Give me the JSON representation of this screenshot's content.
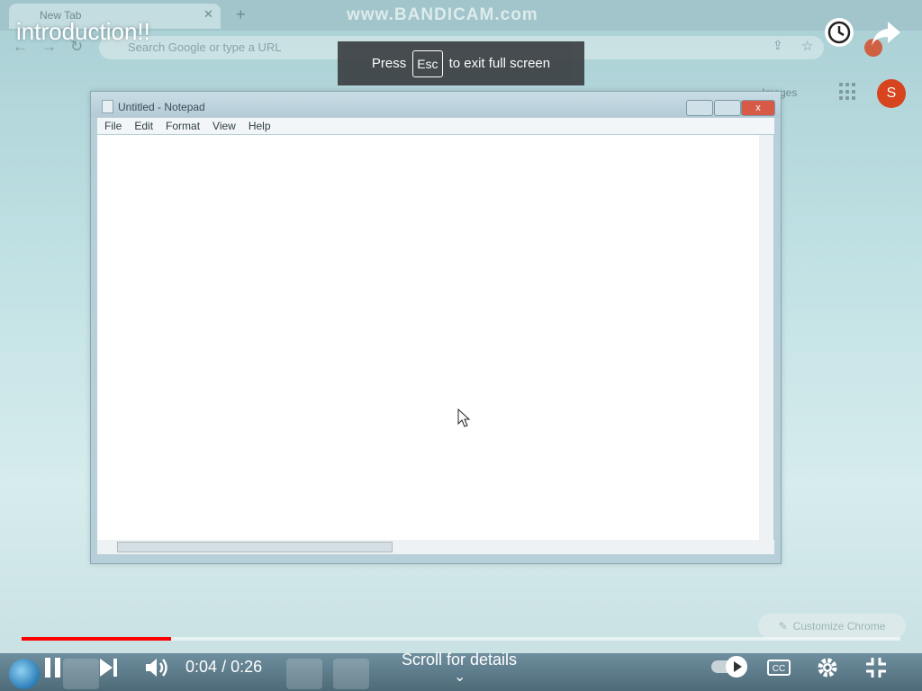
{
  "video": {
    "title": "introduction!!",
    "watermark": "www.BANDICAM.com",
    "time_current": "0:04",
    "time_sep": "/",
    "time_total": "0:26",
    "progress_fraction": 0.17,
    "scroll_hint": "Scroll for details",
    "accent": "#ff0000"
  },
  "toast": {
    "press": "Press",
    "key": "Esc",
    "rest": "to exit full screen"
  },
  "browser": {
    "tab_label": "New Tab",
    "omnibox_placeholder": "Search Google or type a URL",
    "images_link": "Images",
    "avatar_letter": "S",
    "customize_label": "Customize Chrome"
  },
  "notepad": {
    "title": "Untitled - Notepad",
    "menu": [
      "File",
      "Edit",
      "Format",
      "View",
      "Help"
    ],
    "close_glyph": "x"
  }
}
